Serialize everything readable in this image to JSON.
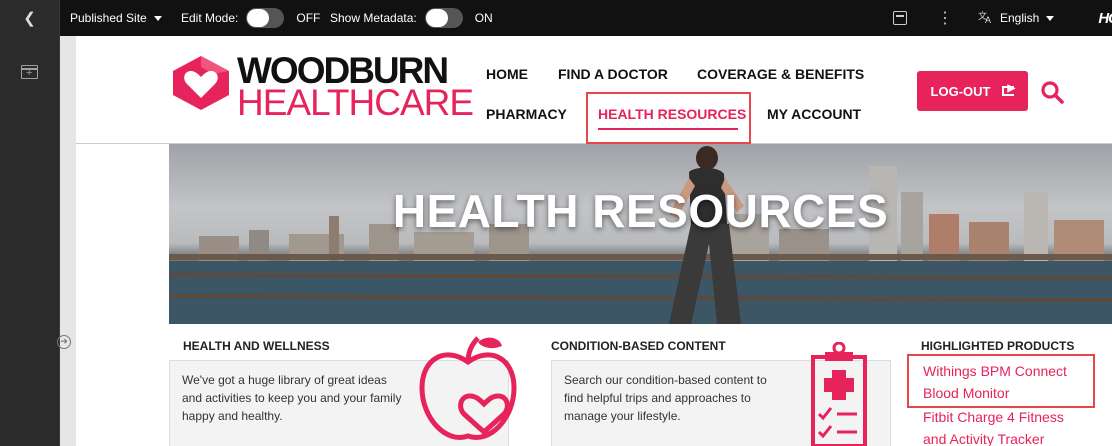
{
  "toolbar": {
    "site_selector": "Published Site",
    "edit_mode_label": "Edit Mode:",
    "edit_mode_state": "OFF",
    "show_metadata_label": "Show Metadata:",
    "show_metadata_state": "ON",
    "menu_dots": "⋮",
    "language": "English",
    "language_icon": "translate-icon",
    "brand_partial": "HC"
  },
  "header": {
    "logo_line1": "WOODBURN",
    "logo_line2": "HEALTHCARE",
    "nav": [
      {
        "label": "HOME"
      },
      {
        "label": "FIND A DOCTOR"
      },
      {
        "label": "COVERAGE & BENEFITS"
      },
      {
        "label": "PHARMACY"
      },
      {
        "label": "HEALTH RESOURCES",
        "active": true
      },
      {
        "label": "MY ACCOUNT"
      }
    ],
    "logout_label": "LOG-OUT",
    "search_icon": "search-icon"
  },
  "hero": {
    "title": "HEALTH RESOURCES"
  },
  "sections": {
    "wellness": {
      "title": "HEALTH AND WELLNESS",
      "text": "We've got a huge library of great ideas and activities to keep you and your family happy and healthy.",
      "icon": "apple-heart-icon"
    },
    "condition": {
      "title": "CONDITION-BASED CONTENT",
      "text": "Search our condition-based content to find helpful trips and approaches to manage your lifestyle.",
      "icon": "medical-clipboard-icon"
    },
    "products": {
      "title": "HIGHLIGHTED PRODUCTS",
      "items": [
        {
          "line1": "Withings BPM Connect",
          "line2": "Blood Monitor"
        },
        {
          "line1": "Fitbit Charge 4 Fitness",
          "line2": "and Activity Tracker"
        }
      ]
    }
  },
  "colors": {
    "brand": "#e6235a",
    "highlight_box": "#e8474a",
    "toolbar_bg": "#111111",
    "panel_bg": "#2b2b2b"
  }
}
